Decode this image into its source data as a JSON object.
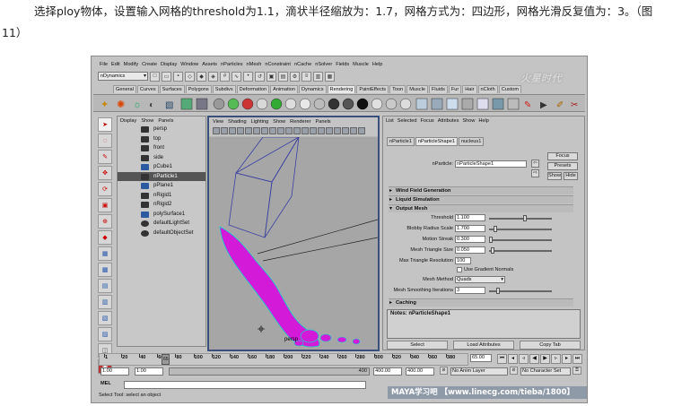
{
  "caption": {
    "line1": "选择ploy物体，设置输入网格的threshold为1.1，滴状半径缩放为：1.7，网格方式为：四边形，网格光滑反复值为：3。（图",
    "line2": "11）"
  },
  "menubar": [
    "File",
    "Edit",
    "Modify",
    "Create",
    "Display",
    "Window",
    "Assets",
    "nParticles",
    "nMesh",
    "nConstraint",
    "nCache",
    "nSolver",
    "Fields",
    "Muscle",
    "Help"
  ],
  "status_line": {
    "menu_set": "nDynamics"
  },
  "shelf_tabs": [
    "General",
    "Curves",
    "Surfaces",
    "Polygons",
    "Subdivs",
    "Deformation",
    "Animation",
    "Dynamics",
    "Rendering",
    "PaintEffects",
    "Toon",
    "Muscle",
    "Fluids",
    "Fur",
    "Hair",
    "nCloth",
    "Custom"
  ],
  "shelf_active_tab": "Rendering",
  "outliner": {
    "menu": [
      "Display",
      "Show",
      "Panels"
    ],
    "items": [
      {
        "label": "persp",
        "selected": false
      },
      {
        "label": "top",
        "selected": false
      },
      {
        "label": "front",
        "selected": false
      },
      {
        "label": "side",
        "selected": false
      },
      {
        "label": "pCube1",
        "selected": false
      },
      {
        "label": "nParticle1",
        "selected": true
      },
      {
        "label": "pPlane1",
        "selected": false
      },
      {
        "label": "nRigid1",
        "selected": false
      },
      {
        "label": "nRigid2",
        "selected": false
      },
      {
        "label": "polySurface1",
        "selected": false
      },
      {
        "label": "defaultLightSet",
        "selected": false
      },
      {
        "label": "defaultObjectSet",
        "selected": false
      }
    ]
  },
  "viewport": {
    "menu": [
      "View",
      "Shading",
      "Lighting",
      "Show",
      "Renderer",
      "Panels"
    ],
    "camera_label": "persp"
  },
  "attribute_editor": {
    "menu": [
      "List",
      "Selected",
      "Focus",
      "Attributes",
      "Show",
      "Help"
    ],
    "tabs": [
      "nParticle1",
      "nParticleShape1",
      "nucleus1"
    ],
    "active_tab": "nParticleShape1",
    "node_label": "nParticle:",
    "node_value": "nParticleShape1",
    "buttons": {
      "focus": "Focus",
      "presets": "Presets",
      "show": "Show",
      "hide": "Hide"
    },
    "sections": {
      "wind": "Wind Field Generation",
      "liquid": "Liquid Simulation",
      "output": "Output Mesh",
      "caching": "Caching"
    },
    "fields": {
      "threshold_label": "Threshold",
      "threshold": "1.100",
      "blobby_label": "Blobby Radius Scale",
      "blobby": "1.700",
      "motion_label": "Motion Streak",
      "motion": "0.300",
      "triangle_label": "Mesh Triangle Size",
      "triangle": "0.050",
      "max_res_label": "Max Triangle Resolution",
      "max_res": "100",
      "gradient_label": "Use Gradient Normals",
      "method_label": "Mesh Method",
      "method": "Quads",
      "smoothing_label": "Mesh Smoothing Iterations",
      "smoothing": "3"
    },
    "notes_label": "Notes:  nParticleShape1",
    "bottom_buttons": [
      "Select",
      "Load Attributes",
      "Copy Tab"
    ]
  },
  "timeline": {
    "ticks": [
      "1",
      "20",
      "40",
      "60",
      "80",
      "100",
      "120",
      "140",
      "160",
      "180",
      "200",
      "220",
      "240",
      "260",
      "280",
      "300",
      "320",
      "340",
      "360",
      "380"
    ],
    "current_frame": "65",
    "current_frame_field": "65.00"
  },
  "range": {
    "start_a": "1.00",
    "start_b": "1.00",
    "marker": "400",
    "end_a": "400.00",
    "end_b": "400.00",
    "anim_layer": "No Anim Layer",
    "char_set": "No Character Set"
  },
  "command_line": {
    "label": "MEL"
  },
  "help_line": "Select Tool: select an object",
  "watermark": "MAYA学习吧 【www.linecg.com/tieba/1800】",
  "colors": {
    "particle": "#d21ad8",
    "particle_outline": "#15d0d0",
    "viewport_bg": "#a6a6a6",
    "selection": "#555555"
  }
}
